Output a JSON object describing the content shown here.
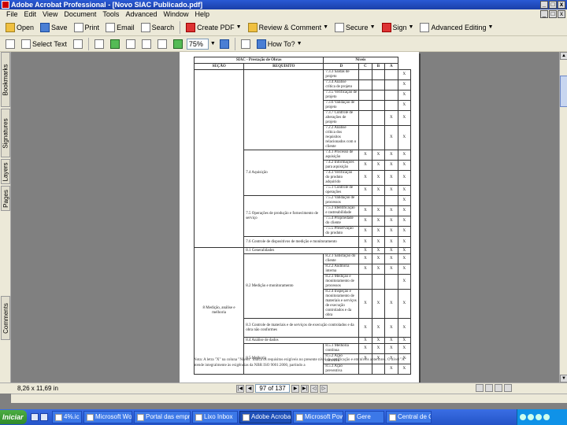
{
  "window": {
    "title": "Adobe Acrobat Professional - [Novo SIAC Publicado.pdf]",
    "controls": [
      "_",
      "□",
      "x"
    ]
  },
  "menu": {
    "items": [
      "File",
      "Edit",
      "View",
      "Document",
      "Tools",
      "Advanced",
      "Window",
      "Help"
    ]
  },
  "toolbar1": {
    "open": "Open",
    "save": "Save",
    "print": "Print",
    "email": "Email",
    "search": "Search",
    "create_pdf": "Create PDF",
    "review": "Review & Comment",
    "secure": "Secure",
    "sign": "Sign",
    "forms": "Advanced Editing"
  },
  "toolbar2": {
    "select_text": "Select Text",
    "zoom_value": "75%",
    "how_to": "How To?"
  },
  "navtabs": [
    "Bookmarks",
    "Signatures",
    "Layers",
    "Pages",
    "Comments"
  ],
  "table": {
    "title": "SIAC - Prestação de Obras",
    "levels_header": "Níveis",
    "col_secao": "SEÇÃO",
    "col_requisito": "REQUISITO",
    "levels": [
      "D",
      "C",
      "B",
      "A"
    ],
    "rows": [
      {
        "req": "7.3.3  Saídas de projeto",
        "d": "",
        "c": "",
        "b": "",
        "a": "X"
      },
      {
        "req": "7.3.4  Análise crítica de projeto",
        "d": "",
        "c": "",
        "b": "",
        "a": "X"
      },
      {
        "req": "7.3.5  Verificação de projeto",
        "d": "",
        "c": "",
        "b": "",
        "a": "X"
      },
      {
        "req": "7.3.6  Validação de projeto",
        "d": "",
        "c": "",
        "b": "",
        "a": "X"
      },
      {
        "req": "7.3.7  Controle de alterações de projeto",
        "d": "",
        "c": "",
        "b": "X",
        "a": "X"
      },
      {
        "req": "7.2.2  Análise crítica dos requisitos relacionados com o cliente",
        "d": "",
        "c": "",
        "b": "X",
        "a": "X"
      },
      {
        "req": "7.4.1  Processo de aquisição",
        "d": "X",
        "c": "X",
        "b": "X",
        "a": "X"
      },
      {
        "req": "7.4.2  Informações para aquisição",
        "d": "X",
        "c": "X",
        "b": "X",
        "a": "X"
      },
      {
        "req": "7.4.3  Verificação do produto adquirido",
        "d": "X",
        "c": "X",
        "b": "X",
        "a": "X"
      },
      {
        "req": "7.5.1  Controle de operações",
        "d": "X",
        "c": "X",
        "b": "X",
        "a": "X"
      },
      {
        "req": "7.5.2  Validação de processos",
        "d": "",
        "c": "",
        "b": "",
        "a": "X"
      },
      {
        "req": "7.5.3  Identificação e rastreabilidade",
        "d": "X",
        "c": "X",
        "b": "X",
        "a": "X"
      },
      {
        "req": "7.5.4  Propriedade do cliente",
        "d": "X",
        "c": "X",
        "b": "X",
        "a": "X"
      },
      {
        "req": "7.5.5  Preservação do produto",
        "d": "X",
        "c": "X",
        "b": "X",
        "a": "X"
      },
      {
        "req": "",
        "d": "X",
        "c": "X",
        "b": "X",
        "a": "X"
      },
      {
        "req": "",
        "d": "X",
        "c": "X",
        "b": "X",
        "a": "X"
      },
      {
        "req": "8.2.1  Satisfação do cliente",
        "d": "X",
        "c": "X",
        "b": "X",
        "a": "X"
      },
      {
        "req": "8.2.2  Auditoria interna",
        "d": "X",
        "c": "X",
        "b": "X",
        "a": "X"
      },
      {
        "req": "8.2.3  Medição e monitoramento de processos",
        "d": "",
        "c": "",
        "b": "",
        "a": "X"
      },
      {
        "req": "8.2.4  Inspeção e monitoramento de materiais e serviços de execução controlados e da obra",
        "d": "X",
        "c": "X",
        "b": "X",
        "a": "X"
      },
      {
        "req": "",
        "d": "X",
        "c": "X",
        "b": "X",
        "a": "X"
      },
      {
        "req": "",
        "d": "X",
        "c": "X",
        "b": "X",
        "a": "X"
      },
      {
        "req": "8.5.1  Melhoria contínua",
        "d": "X",
        "c": "X",
        "b": "X",
        "a": "X"
      },
      {
        "req": "8.5.2  Ação corretiva",
        "d": "X",
        "c": "X",
        "b": "X",
        "a": "X"
      },
      {
        "req": "8.5.3  Ação preventiva",
        "d": "",
        "c": "",
        "b": "X",
        "a": "X"
      }
    ],
    "mid": {
      "aquisicao": "7.4  Aquisição",
      "operacoes": "7.5  Operações de produção e fornecimento de serviço",
      "disp_controle": "7.6  Controle de dispositivos de medição e monitoramento",
      "generalidades": "8.1  Generalidades",
      "medicao": "8.2  Medição e monitoramento",
      "ctrl_mat": "8.3  Controle de materiais e de serviços de execução controlados e da obra não conformes",
      "analise": "8.4  Análise de dados",
      "melhoria": "8.5  Melhoria"
    },
    "sec8": "8  Medição, análise e melhoria"
  },
  "note": "Nota: A letra \"X\" na coluna \"Níveis\" indica os requisitos exigíveis no presente nível de certificação e em níveis anteriores. O nível \"A\" atende integralmente às exigências da NBR ISO 9001:2000, partindo a",
  "status": {
    "page_size": "8,26 x 11,69 in",
    "page_indicator": "97 of 137"
  },
  "taskbar": {
    "start": "Iniciar",
    "tasks": [
      {
        "label": "4%.ic",
        "active": false
      },
      {
        "label": "Microsoft Word",
        "active": false
      },
      {
        "label": "Portal das empresas",
        "active": false
      },
      {
        "label": "Lixo Inbox",
        "active": false
      },
      {
        "label": "Adobe Acrobat Professional",
        "active": true
      },
      {
        "label": "Microsoft PowerPoint",
        "active": false
      },
      {
        "label": "Gere",
        "active": false
      },
      {
        "label": "Central de Client.",
        "active": false
      }
    ]
  }
}
